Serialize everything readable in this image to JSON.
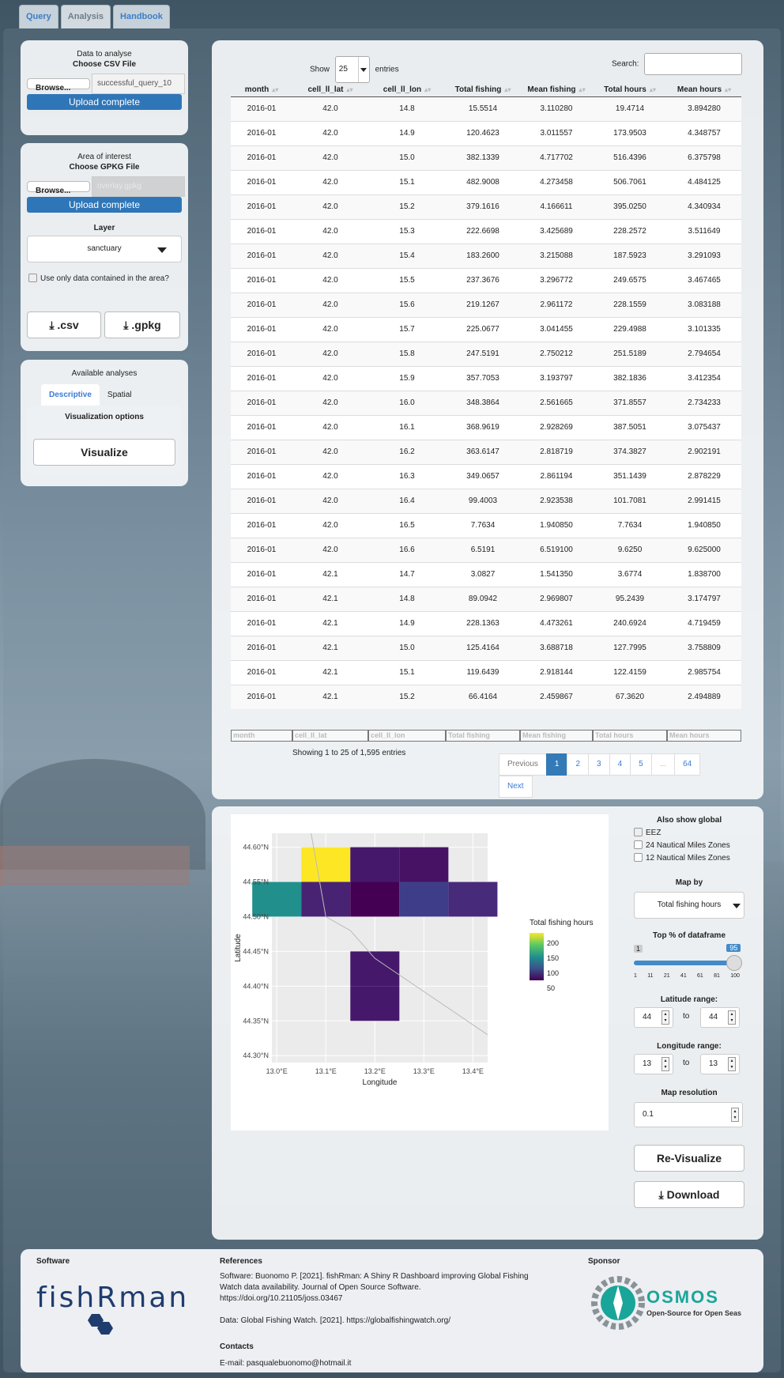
{
  "tabs": [
    "Query",
    "Analysis",
    "Handbook"
  ],
  "data_panel": {
    "title": "Data to analyse",
    "file_label": "Choose CSV File",
    "browse": "Browse...",
    "filename": "successful_query_10",
    "status": "Upload complete"
  },
  "area_panel": {
    "title": "Area of interest",
    "file_label": "Choose GPKG File",
    "browse": "Browse...",
    "filename": "overlay.gpkg",
    "status": "Upload complete",
    "layer_label": "Layer",
    "layer_value": "sanctuary",
    "only_area_label": "Use only data contained in the area?",
    "csv_btn": ".csv",
    "gpkg_btn": ".gpkg"
  },
  "analyses_panel": {
    "title": "Available analyses",
    "tabs": [
      "Descriptive",
      "Spatial"
    ],
    "vis_options": "Visualization options",
    "visualize": "Visualize"
  },
  "table": {
    "show_label": "Show",
    "entries_value": "25",
    "entries_label": "entries",
    "search_label": "Search:",
    "columns": [
      "month",
      "cell_ll_lat",
      "cell_ll_lon",
      "Total fishing",
      "Mean fishing",
      "Total hours",
      "Mean hours"
    ],
    "rows": [
      [
        "2016-01",
        "42.0",
        "14.8",
        "15.5514",
        "3.110280",
        "19.4714",
        "3.894280"
      ],
      [
        "2016-01",
        "42.0",
        "14.9",
        "120.4623",
        "3.011557",
        "173.9503",
        "4.348757"
      ],
      [
        "2016-01",
        "42.0",
        "15.0",
        "382.1339",
        "4.717702",
        "516.4396",
        "6.375798"
      ],
      [
        "2016-01",
        "42.0",
        "15.1",
        "482.9008",
        "4.273458",
        "506.7061",
        "4.484125"
      ],
      [
        "2016-01",
        "42.0",
        "15.2",
        "379.1616",
        "4.166611",
        "395.0250",
        "4.340934"
      ],
      [
        "2016-01",
        "42.0",
        "15.3",
        "222.6698",
        "3.425689",
        "228.2572",
        "3.511649"
      ],
      [
        "2016-01",
        "42.0",
        "15.4",
        "183.2600",
        "3.215088",
        "187.5923",
        "3.291093"
      ],
      [
        "2016-01",
        "42.0",
        "15.5",
        "237.3676",
        "3.296772",
        "249.6575",
        "3.467465"
      ],
      [
        "2016-01",
        "42.0",
        "15.6",
        "219.1267",
        "2.961172",
        "228.1559",
        "3.083188"
      ],
      [
        "2016-01",
        "42.0",
        "15.7",
        "225.0677",
        "3.041455",
        "229.4988",
        "3.101335"
      ],
      [
        "2016-01",
        "42.0",
        "15.8",
        "247.5191",
        "2.750212",
        "251.5189",
        "2.794654"
      ],
      [
        "2016-01",
        "42.0",
        "15.9",
        "357.7053",
        "3.193797",
        "382.1836",
        "3.412354"
      ],
      [
        "2016-01",
        "42.0",
        "16.0",
        "348.3864",
        "2.561665",
        "371.8557",
        "2.734233"
      ],
      [
        "2016-01",
        "42.0",
        "16.1",
        "368.9619",
        "2.928269",
        "387.5051",
        "3.075437"
      ],
      [
        "2016-01",
        "42.0",
        "16.2",
        "363.6147",
        "2.818719",
        "374.3827",
        "2.902191"
      ],
      [
        "2016-01",
        "42.0",
        "16.3",
        "349.0657",
        "2.861194",
        "351.1439",
        "2.878229"
      ],
      [
        "2016-01",
        "42.0",
        "16.4",
        "99.4003",
        "2.923538",
        "101.7081",
        "2.991415"
      ],
      [
        "2016-01",
        "42.0",
        "16.5",
        "7.7634",
        "1.940850",
        "7.7634",
        "1.940850"
      ],
      [
        "2016-01",
        "42.0",
        "16.6",
        "6.5191",
        "6.519100",
        "9.6250",
        "9.625000"
      ],
      [
        "2016-01",
        "42.1",
        "14.7",
        "3.0827",
        "1.541350",
        "3.6774",
        "1.838700"
      ],
      [
        "2016-01",
        "42.1",
        "14.8",
        "89.0942",
        "2.969807",
        "95.2439",
        "3.174797"
      ],
      [
        "2016-01",
        "42.1",
        "14.9",
        "228.1363",
        "4.473261",
        "240.6924",
        "4.719459"
      ],
      [
        "2016-01",
        "42.1",
        "15.0",
        "125.4164",
        "3.688718",
        "127.7995",
        "3.758809"
      ],
      [
        "2016-01",
        "42.1",
        "15.1",
        "119.6439",
        "2.918144",
        "122.4159",
        "2.985754"
      ],
      [
        "2016-01",
        "42.1",
        "15.2",
        "66.4164",
        "2.459867",
        "67.3620",
        "2.494889"
      ]
    ],
    "info": "Showing 1 to 25 of 1,595 entries",
    "pagination": [
      "Previous",
      "1",
      "2",
      "3",
      "4",
      "5",
      "...",
      "64"
    ],
    "next": "Next"
  },
  "map": {
    "y_ticks": [
      "44.60°N",
      "44.55°N",
      "44.50°N",
      "44.45°N",
      "44.40°N",
      "44.35°N",
      "44.30°N"
    ],
    "x_ticks": [
      "13.0°E",
      "13.1°E",
      "13.2°E",
      "13.3°E",
      "13.4°E"
    ],
    "xlabel": "Longitude",
    "ylabel": "Latitude",
    "legend_title": "Total fishing hours",
    "legend_ticks": [
      "200",
      "150",
      "100",
      "50"
    ],
    "colors": {
      "yellow": "#fde725",
      "teal": "#21908d",
      "dark": "#440154",
      "purple1": "#46186c",
      "purple2": "#471164",
      "blue": "#3e3d89"
    },
    "cells": [
      {
        "lon": 13.1,
        "lat": 44.55,
        "fill": "#fde725"
      },
      {
        "lon": 13.2,
        "lat": 44.55,
        "fill": "#46186c"
      },
      {
        "lon": 13.3,
        "lat": 44.55,
        "fill": "#471164"
      },
      {
        "lon": 13.0,
        "lat": 44.5,
        "fill": "#21908d"
      },
      {
        "lon": 13.1,
        "lat": 44.5,
        "fill": "#482374"
      },
      {
        "lon": 13.2,
        "lat": 44.5,
        "fill": "#440154"
      },
      {
        "lon": 13.3,
        "lat": 44.5,
        "fill": "#3e3d89"
      },
      {
        "lon": 13.4,
        "lat": 44.5,
        "fill": "#472a7a"
      },
      {
        "lon": 13.2,
        "lat": 44.4,
        "fill": "#46186c"
      },
      {
        "lon": 13.2,
        "lat": 44.35,
        "fill": "#46186c"
      }
    ]
  },
  "map_controls": {
    "also_show": "Also show global",
    "eez": "EEZ",
    "nm24": "24 Nautical Miles Zones",
    "nm12": "12 Nautical Miles Zones",
    "map_by_label": "Map by",
    "map_by_value": "Total fishing hours",
    "top_label": "Top % of dataframe",
    "slider_min": "1",
    "slider_val": "95",
    "slider_level": 0.95,
    "slider_ticks": [
      "1",
      "11",
      "21",
      "41",
      "61",
      "81",
      "100"
    ],
    "lat_label": "Latitude range:",
    "lat_from": "44",
    "lat_to": "44",
    "lon_label": "Longitude range:",
    "lon_from": "13",
    "lon_to": "13",
    "to": "to",
    "res_label": "Map resolution",
    "res_value": "0.1",
    "revisualize": "Re-Visualize",
    "download": "Download"
  },
  "footer": {
    "software_h": "Software",
    "logo_text": "fishRman",
    "refs_h": "References",
    "ref1": "Software: Buonomo P. [2021]. fishRman: A Shiny R Dashboard improving Global Fishing Watch data availability. Journal of Open Source Software. https://doi.org/10.21105/joss.03467",
    "ref2": "Data: Global Fishing Watch. [2021]. https://globalfishingwatch.org/",
    "contacts_h": "Contacts",
    "email": "E-mail: pasqualebuonomo@hotmail.it",
    "sponsor_h": "Sponsor",
    "sponsor_name": "OSMOS",
    "sponsor_sub": "Open-Source for Open Seas"
  }
}
